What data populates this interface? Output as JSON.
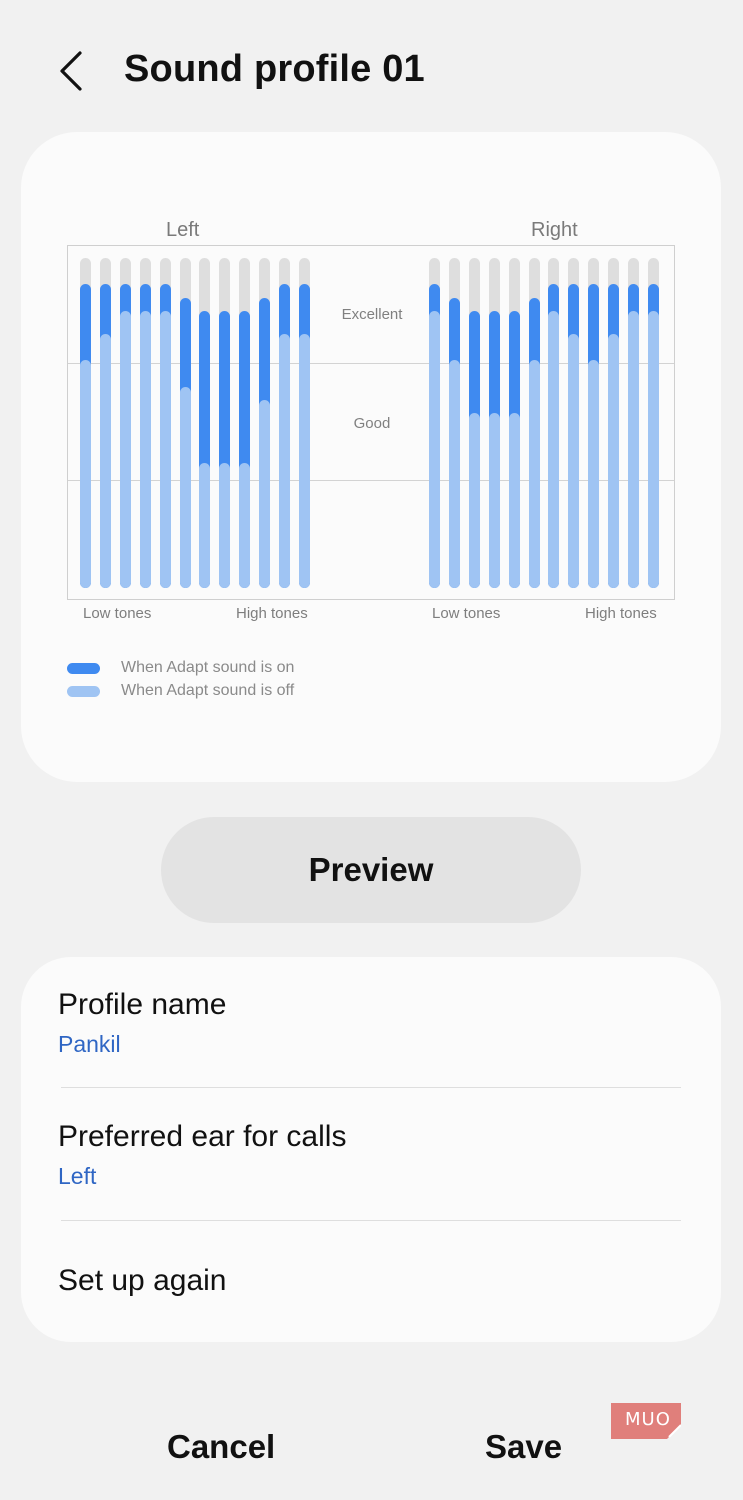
{
  "header": {
    "title": "Sound profile 01",
    "back_icon": "chevron-left-icon"
  },
  "chart": {
    "left_label": "Left",
    "right_label": "Right",
    "band_labels": {
      "excellent": "Excellent",
      "good": "Good"
    },
    "tone_labels": {
      "low": "Low tones",
      "high": "High tones"
    },
    "legend": {
      "on": {
        "label": "When Adapt sound is on",
        "color": "#3f8af0"
      },
      "off": {
        "label": "When Adapt sound is off",
        "color": "#9fc4f3"
      }
    },
    "track_color": "#dedede"
  },
  "chart_data": {
    "type": "bar",
    "scale": "fraction of bar height (0 = bottom, 1 = top)",
    "series": [
      {
        "name": "Left",
        "adapt_on": [
          0.92,
          0.92,
          0.92,
          0.92,
          0.92,
          0.88,
          0.84,
          0.84,
          0.84,
          0.88,
          0.92,
          0.92
        ],
        "adapt_off": [
          0.69,
          0.77,
          0.84,
          0.84,
          0.84,
          0.61,
          0.38,
          0.38,
          0.38,
          0.57,
          0.77,
          0.77
        ]
      },
      {
        "name": "Right",
        "adapt_on": [
          0.92,
          0.88,
          0.84,
          0.84,
          0.84,
          0.88,
          0.92,
          0.92,
          0.92,
          0.92,
          0.92,
          0.92
        ],
        "adapt_off": [
          0.84,
          0.69,
          0.53,
          0.53,
          0.53,
          0.69,
          0.84,
          0.77,
          0.69,
          0.77,
          0.84,
          0.84
        ]
      }
    ]
  },
  "preview_button": {
    "label": "Preview"
  },
  "settings": {
    "profile_name": {
      "title": "Profile name",
      "value": "Pankil"
    },
    "preferred_ear": {
      "title": "Preferred ear for calls",
      "value": "Left"
    },
    "setup_again": {
      "title": "Set up again"
    }
  },
  "footer": {
    "cancel": "Cancel",
    "save": "Save"
  },
  "watermark": {
    "text": "MUO"
  }
}
